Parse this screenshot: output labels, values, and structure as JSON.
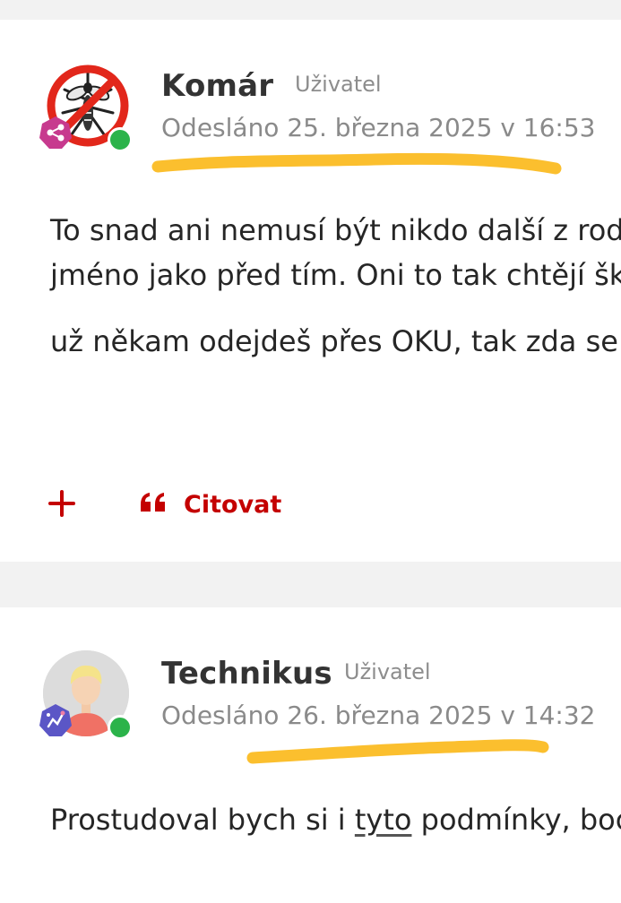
{
  "posts": [
    {
      "author": "Komár",
      "role": "Uživatel",
      "date": "Odesláno 25. března 2025 v 16:53",
      "body_lines": [
        "To snad ani nemusí být nikdo další z rodi",
        "jméno jako před tím. Oni to tak chtějí škr",
        "už někam odejdeš přes OKU, tak zda se v"
      ],
      "actions": {
        "plus_icon": "plus-icon",
        "quote_icon": "quote-icon",
        "quote_label": "Citovat"
      }
    },
    {
      "author": "Technikus",
      "role": "Uživatel",
      "date": "Odesláno 26. března 2025 v 14:32",
      "body_before": "Prostudoval bych si i ",
      "body_link": "tyto",
      "body_after": " podmínky, boc"
    }
  ],
  "colors": {
    "accent": "#c40000",
    "online": "#2bb34a",
    "highlight": "#fbbf2e",
    "background": "#f2f2f2"
  }
}
